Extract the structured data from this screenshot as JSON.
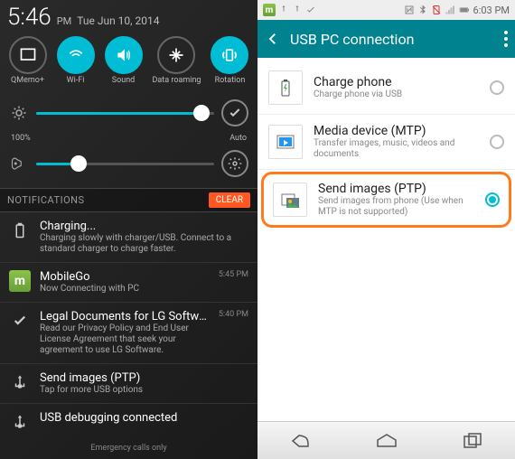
{
  "left": {
    "clock": "5:46",
    "ampm": "PM",
    "date": "Tue Jun 10, 2014",
    "toggles": [
      {
        "label": "QMemo+",
        "active": false
      },
      {
        "label": "Wi-Fi",
        "active": true
      },
      {
        "label": "Sound",
        "active": true
      },
      {
        "label": "Data roaming",
        "active": false
      },
      {
        "label": "Rotation",
        "active": true
      }
    ],
    "brightness_pct": "100%",
    "brightness_value": 93,
    "auto_label": "Auto",
    "volume_value": 24,
    "notif_header": "NOTIFICATIONS",
    "clear_label": "CLEAR",
    "notifications": [
      {
        "title": "Charging...",
        "text": "Charging slowly with charger/USB. Connect to a standard charger to charge faster.",
        "time": ""
      },
      {
        "title": "MobileGo",
        "text": "Now Connecting with PC",
        "time": "5:45 PM"
      },
      {
        "title": "Legal Documents for LG Software",
        "text": "Read our Privacy Policy and End User License Agreement that seek your agreement to use LG Software.",
        "time": "5:40 PM"
      },
      {
        "title": "Send images (PTP)",
        "text": "Tap for more USB options",
        "time": ""
      },
      {
        "title": "USB debugging connected",
        "text": "",
        "time": ""
      }
    ],
    "footer": "Emergency calls only"
  },
  "right": {
    "status_time": "6:03 PM",
    "title": "USB PC connection",
    "options": [
      {
        "title": "Charge phone",
        "desc": "Charge phone via USB",
        "checked": false
      },
      {
        "title": "Media device (MTP)",
        "desc": "Transfer images, music, videos and documents",
        "checked": false
      },
      {
        "title": "Send images (PTP)",
        "desc": "Send images from phone (Use when MTP is not supported)",
        "checked": true
      }
    ]
  }
}
